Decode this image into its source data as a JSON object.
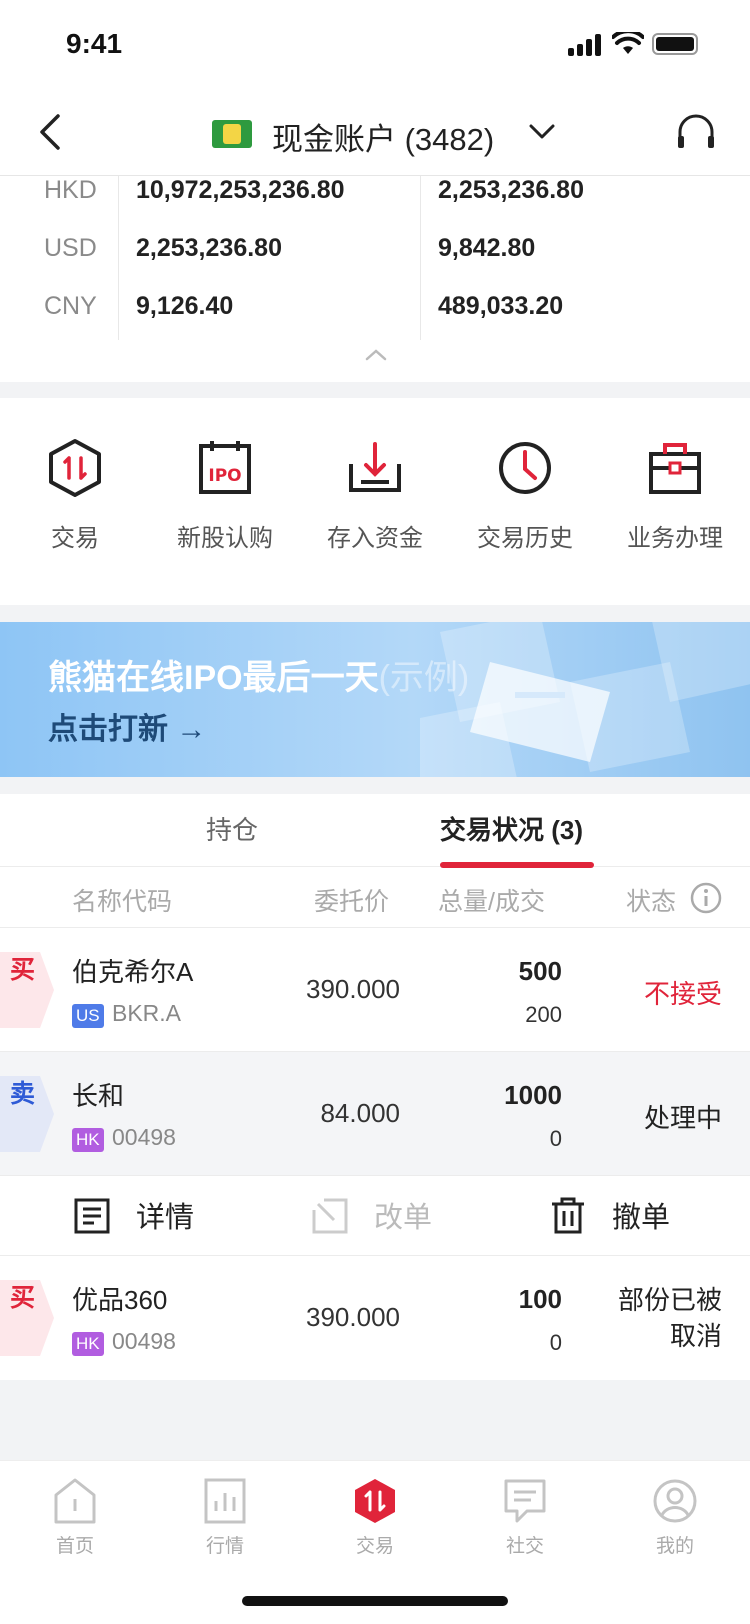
{
  "status_bar": {
    "time": "9:41"
  },
  "nav": {
    "account_title": "现金账户 (3482)"
  },
  "balances": [
    {
      "currency": "HKD",
      "value1": "10,972,253,236.80",
      "value2": "2,253,236.80"
    },
    {
      "currency": "USD",
      "value1": "2,253,236.80",
      "value2": "9,842.80"
    },
    {
      "currency": "CNY",
      "value1": "9,126.40",
      "value2": "489,033.20"
    }
  ],
  "quick_actions": [
    {
      "label": "交易",
      "icon": "trade-hexagon-icon"
    },
    {
      "label": "新股认购",
      "icon": "ipo-calendar-icon"
    },
    {
      "label": "存入资金",
      "icon": "deposit-tray-icon"
    },
    {
      "label": "交易历史",
      "icon": "clock-icon"
    },
    {
      "label": "业务办理",
      "icon": "briefcase-icon"
    }
  ],
  "banner": {
    "title": "熊猫在线IPO最后一天",
    "title_example": "(示例)",
    "cta": "点击打新 →"
  },
  "tabs": [
    {
      "label": "持仓",
      "active": false
    },
    {
      "label": "交易状况 (3)",
      "active": true
    }
  ],
  "table_headers": {
    "name_code": "名称代码",
    "price": "委托价",
    "qty_filled": "总量/成交",
    "status": "状态"
  },
  "orders": [
    {
      "side": "买",
      "name": "伯克希尔A",
      "market": "US",
      "code": "BKR.A",
      "price": "390.000",
      "qty": "500",
      "filled": "200",
      "status": "不接受"
    },
    {
      "side": "卖",
      "name": "长和",
      "market": "HK",
      "code": "00498",
      "price": "84.000",
      "qty": "1000",
      "filled": "0",
      "status": "处理中"
    },
    {
      "side": "买",
      "name": "优品360",
      "market": "HK",
      "code": "00498",
      "price": "390.000",
      "qty": "100",
      "filled": "0",
      "status_line1": "部份已被",
      "status_line2": "取消"
    }
  ],
  "order_actions": {
    "details": "详情",
    "modify": "改单",
    "cancel": "撤单"
  },
  "tab_bar": [
    {
      "label": "首页",
      "icon": "home-icon"
    },
    {
      "label": "行情",
      "icon": "market-chart-icon"
    },
    {
      "label": "交易",
      "icon": "trade-hexagon-icon"
    },
    {
      "label": "社交",
      "icon": "chat-bubble-icon"
    },
    {
      "label": "我的",
      "icon": "profile-icon"
    }
  ],
  "colors": {
    "accent_red": "#e0243a",
    "buy_red": "#e0243a",
    "sell_blue": "#2f5bd6",
    "us_badge": "#4f7be8",
    "hk_badge": "#b15de0"
  }
}
